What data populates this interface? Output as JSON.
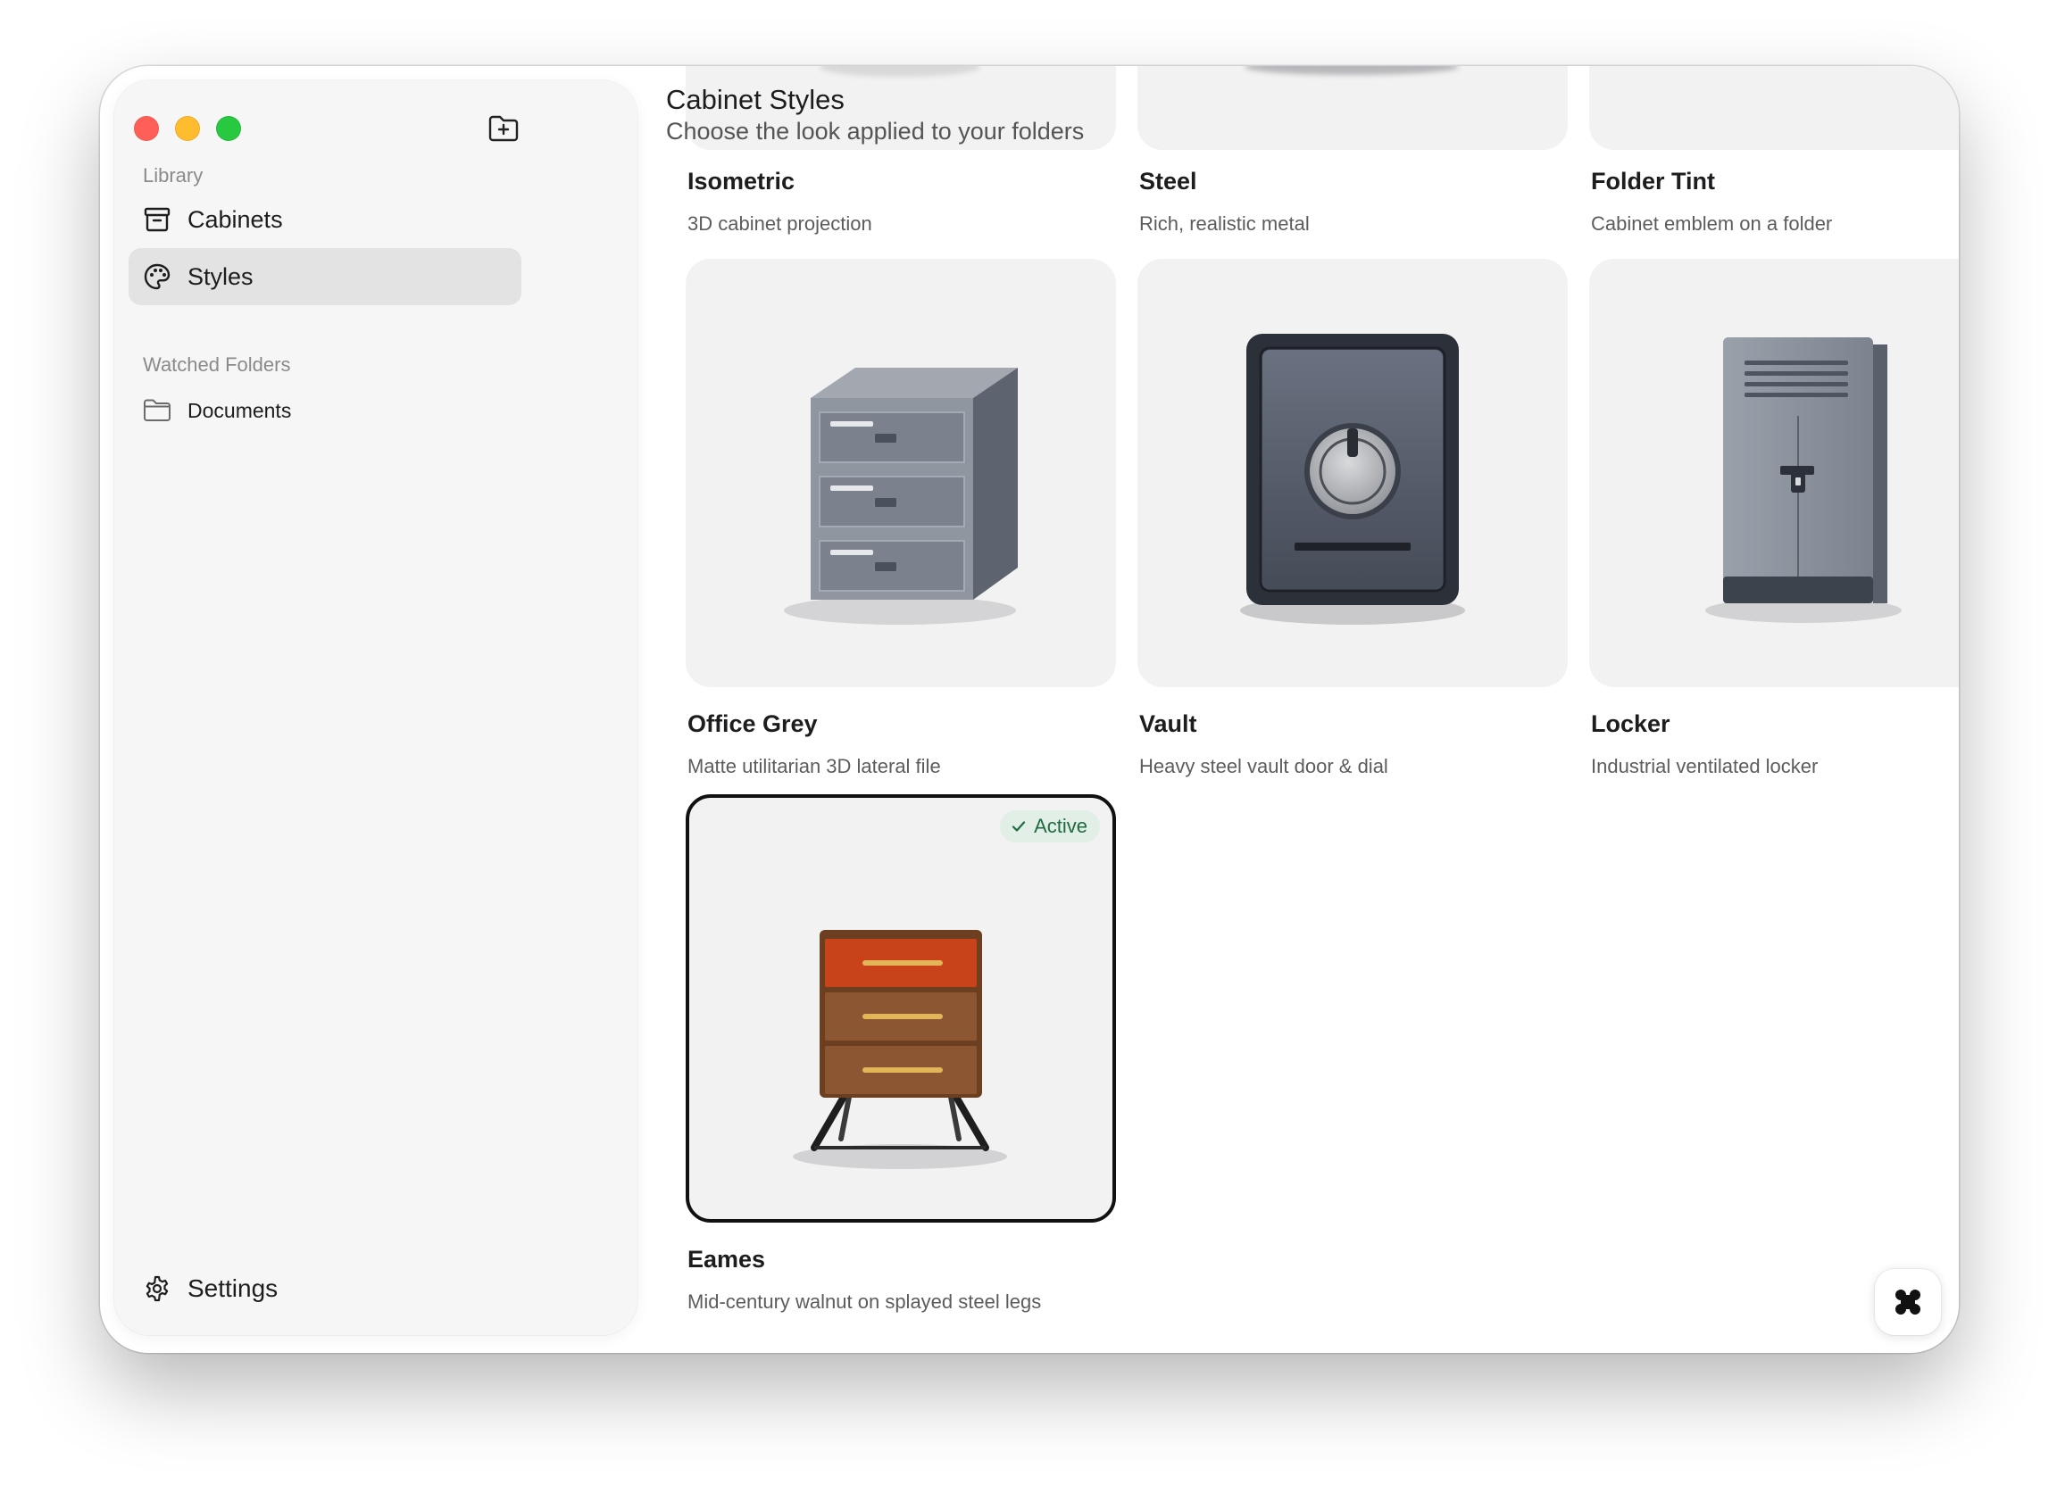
{
  "sidebar": {
    "library_label": "Library",
    "items": [
      {
        "label": "Cabinets",
        "icon": "archive-icon"
      },
      {
        "label": "Styles",
        "icon": "palette-icon",
        "selected": true
      }
    ],
    "watched_label": "Watched Folders",
    "folders": [
      {
        "label": "Documents",
        "icon": "folder-icon"
      }
    ],
    "settings_label": "Settings"
  },
  "header": {
    "title": "Cabinet Styles",
    "subtitle": "Choose the look applied to your folders"
  },
  "styles": [
    {
      "title": "Isometric",
      "desc": "3D cabinet projection"
    },
    {
      "title": "Steel",
      "desc": "Rich, realistic metal"
    },
    {
      "title": "Folder Tint",
      "desc": "Cabinet emblem on a folder"
    },
    {
      "title": "Office Grey",
      "desc": "Matte utilitarian 3D lateral file"
    },
    {
      "title": "Vault",
      "desc": "Heavy steel vault door & dial"
    },
    {
      "title": "Locker",
      "desc": "Industrial ventilated locker"
    },
    {
      "title": "Eames",
      "desc": "Mid-century walnut on splayed steel legs",
      "active": true
    }
  ],
  "active_badge": "Active",
  "colors": {
    "accent_badge_bg": "#e1efe6",
    "accent_badge_text": "#1f6b3f",
    "selected_nav": "#e3e3e3",
    "close": "#ff5f57",
    "minimize": "#febc2e",
    "maximize": "#28c840"
  }
}
